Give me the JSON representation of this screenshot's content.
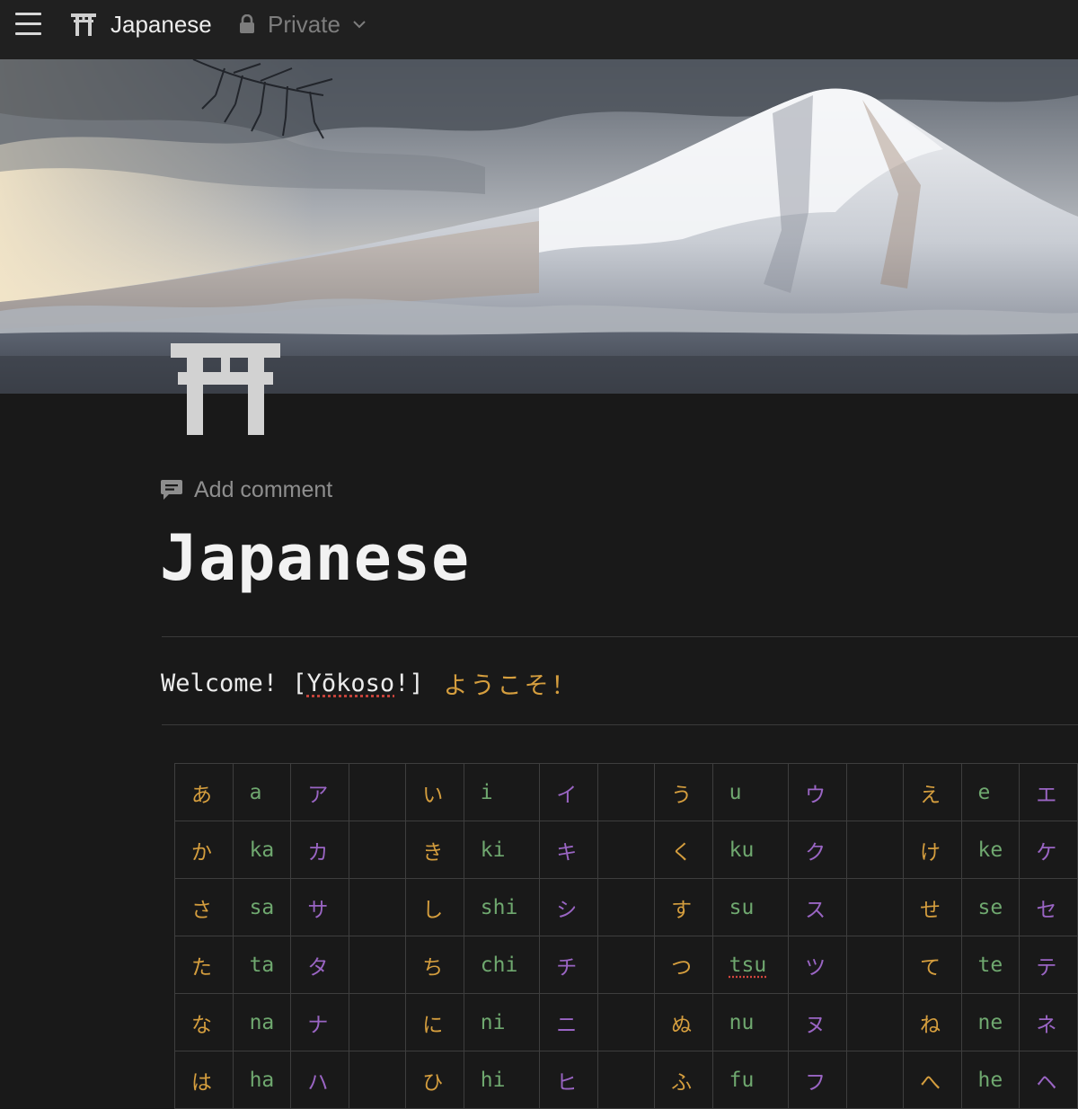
{
  "topbar": {
    "menu_icon": "hamburger-menu-icon",
    "page_icon": "torii-gate-icon",
    "title": "Japanese",
    "privacy_icon": "lock-icon",
    "privacy_label": "Private",
    "privacy_chevron": "chevron-down-icon"
  },
  "cover": {
    "image": "mount-fuji-snow-cover-photo"
  },
  "page": {
    "icon": "torii-gate-icon",
    "add_comment_label": "Add comment",
    "title": "Japanese",
    "welcome": {
      "prefix": "Welcome! [",
      "romaji": "Yōkoso",
      "suffix": "!]",
      "japanese": "ようこそ！"
    }
  },
  "colors": {
    "hiragana": "#d59e3e",
    "romaji": "#6fa86f",
    "katakana": "#9a65c4",
    "background": "#191919"
  },
  "kana_table": {
    "rows": [
      [
        [
          "あ",
          "a",
          "ア"
        ],
        [
          "い",
          "i",
          "イ"
        ],
        [
          "う",
          "u",
          "ウ"
        ],
        [
          "え",
          "e",
          "エ"
        ]
      ],
      [
        [
          "か",
          "ka",
          "カ"
        ],
        [
          "き",
          "ki",
          "キ"
        ],
        [
          "く",
          "ku",
          "ク"
        ],
        [
          "け",
          "ke",
          "ケ"
        ]
      ],
      [
        [
          "さ",
          "sa",
          "サ"
        ],
        [
          "し",
          "shi",
          "シ"
        ],
        [
          "す",
          "su",
          "ス"
        ],
        [
          "せ",
          "se",
          "セ"
        ]
      ],
      [
        [
          "た",
          "ta",
          "タ"
        ],
        [
          "ち",
          "chi",
          "チ"
        ],
        [
          "つ",
          "tsu",
          "ツ"
        ],
        [
          "て",
          "te",
          "テ"
        ]
      ],
      [
        [
          "な",
          "na",
          "ナ"
        ],
        [
          "に",
          "ni",
          "ニ"
        ],
        [
          "ぬ",
          "nu",
          "ヌ"
        ],
        [
          "ね",
          "ne",
          "ネ"
        ]
      ],
      [
        [
          "は",
          "ha",
          "ハ"
        ],
        [
          "ひ",
          "hi",
          "ヒ"
        ],
        [
          "ふ",
          "fu",
          "フ"
        ],
        [
          "へ",
          "he",
          "ヘ"
        ]
      ]
    ]
  }
}
